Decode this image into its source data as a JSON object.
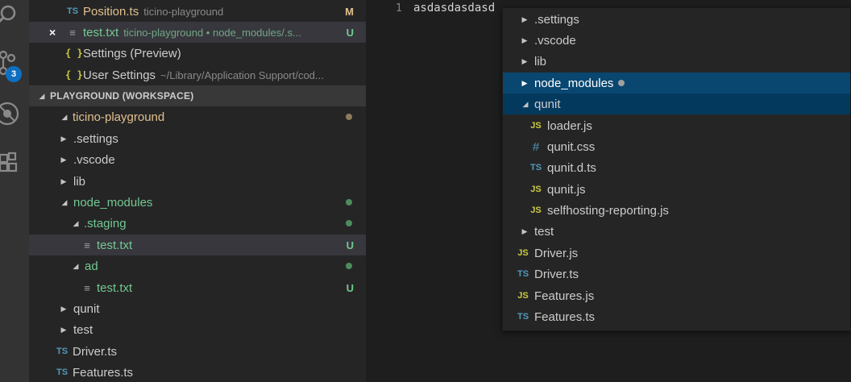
{
  "colors": {
    "modified": "#e2c08d",
    "untracked": "#73c991",
    "dot_modified": "#8c7b5b",
    "dot_untracked": "#4c8c5c",
    "badge": "#0e70c0",
    "focus": "#094771"
  },
  "activity_bar": {
    "icons": [
      "search-icon",
      "source-control-icon",
      "debug-icon",
      "extensions-icon"
    ],
    "scm_badge": "3"
  },
  "open_editors": [
    {
      "icon": "TS",
      "label": "Position.ts",
      "desc": "ticino-playground",
      "status": "M"
    },
    {
      "icon": "≡",
      "label": "test.txt",
      "desc": "ticino-playground • node_modules/.s...",
      "status": "U",
      "close": "×"
    },
    {
      "icon": "{ }",
      "label": "Settings (Preview)"
    },
    {
      "icon": "{ }",
      "label": "User Settings",
      "desc": "~/Library/Application Support/cod..."
    }
  ],
  "workspace": {
    "header": "PLAYGROUND (WORKSPACE)",
    "tree": [
      {
        "label": "ticino-playground",
        "status": ""
      },
      {
        "label": ".settings"
      },
      {
        "label": ".vscode"
      },
      {
        "label": "lib"
      },
      {
        "label": "node_modules"
      },
      {
        "label": ".staging"
      },
      {
        "icon": "≡",
        "label": "test.txt",
        "status": "U"
      },
      {
        "label": "ad"
      },
      {
        "icon": "≡",
        "label": "test.txt",
        "status": "U"
      },
      {
        "label": "qunit"
      },
      {
        "label": "test"
      },
      {
        "icon": "TS",
        "label": "Driver.ts"
      },
      {
        "icon": "TS",
        "label": "Features.ts"
      }
    ]
  },
  "editor": {
    "line_number": "1",
    "content": "asdasdasdasd"
  },
  "dropdown": {
    "items": [
      {
        "label": ".settings"
      },
      {
        "label": ".vscode"
      },
      {
        "label": "lib"
      },
      {
        "label": "node_modules"
      },
      {
        "label": "qunit"
      },
      {
        "icon": "JS",
        "label": "loader.js"
      },
      {
        "icon": "#",
        "label": "qunit.css"
      },
      {
        "icon": "TS",
        "label": "qunit.d.ts"
      },
      {
        "icon": "JS",
        "label": "qunit.js"
      },
      {
        "icon": "JS",
        "label": "selfhosting-reporting.js"
      },
      {
        "label": "test"
      },
      {
        "icon": "JS",
        "label": "Driver.js"
      },
      {
        "icon": "TS",
        "label": "Driver.ts"
      },
      {
        "icon": "JS",
        "label": "Features.js"
      },
      {
        "icon": "TS",
        "label": "Features.ts"
      }
    ]
  }
}
